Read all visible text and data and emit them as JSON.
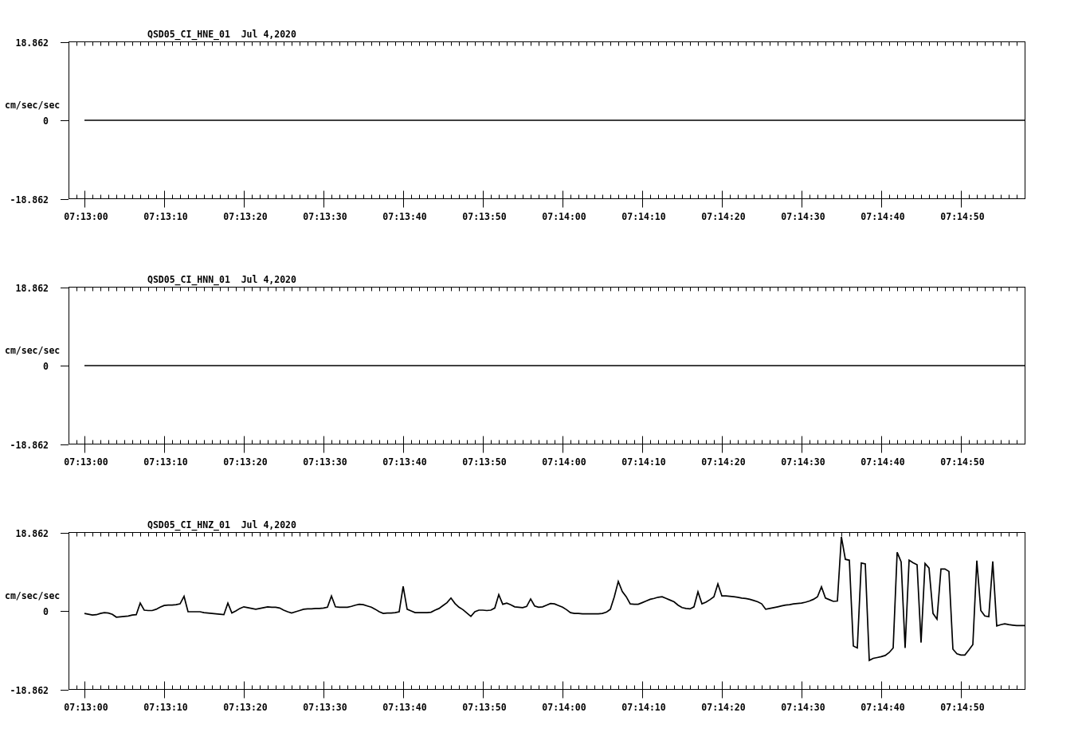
{
  "panels": [
    {
      "chart_data": {
        "type": "line",
        "title": "QSD05_CI_HNE_01  Jul 4,2020",
        "ylabel": "cm/sec/sec",
        "ylim": [
          -18.862,
          18.862
        ],
        "yticks": [
          {
            "value": 18.862,
            "label": "18.862"
          },
          {
            "value": 0,
            "label": "0"
          },
          {
            "value": -18.862,
            "label": "-18.862"
          }
        ],
        "categories": [
          null,
          "07:13:00",
          null,
          null,
          null,
          null,
          "07:13:10",
          null,
          null,
          null,
          null,
          "07:13:20",
          null,
          null,
          null,
          null,
          "07:13:30",
          null,
          null,
          null,
          null,
          "07:13:40",
          null,
          null,
          null,
          null,
          "07:13:50",
          null,
          null,
          null,
          null,
          "07:14:00",
          null,
          null,
          null,
          null,
          "07:14:10",
          null,
          null,
          null,
          null,
          "07:14:20",
          null,
          null,
          null,
          null,
          "07:14:30",
          null,
          null,
          null,
          null,
          "07:14:40",
          null,
          null,
          null,
          null,
          "07:14:50",
          null,
          null,
          null,
          null
        ],
        "values": [
          null,
          0,
          0,
          0,
          0,
          0,
          0,
          0,
          0,
          0,
          0,
          0,
          0,
          0,
          0,
          0,
          0,
          0,
          0,
          0,
          0,
          0,
          0,
          0,
          0,
          0,
          0,
          0,
          0,
          0,
          0,
          0,
          0,
          0,
          0,
          0,
          0,
          0,
          0,
          0,
          0,
          0,
          0,
          0,
          0,
          0,
          0,
          0,
          0,
          0,
          0,
          0,
          0,
          0,
          0,
          0,
          0,
          0,
          0,
          0,
          0
        ]
      }
    },
    {
      "chart_data": {
        "type": "line",
        "title": "QSD05_CI_HNN_01  Jul 4,2020",
        "ylabel": "cm/sec/sec",
        "ylim": [
          -18.862,
          18.862
        ],
        "yticks": [
          {
            "value": 18.862,
            "label": "18.862"
          },
          {
            "value": 0,
            "label": "0"
          },
          {
            "value": -18.862,
            "label": "-18.862"
          }
        ],
        "categories": [
          null,
          "07:13:00",
          null,
          null,
          null,
          null,
          "07:13:10",
          null,
          null,
          null,
          null,
          "07:13:20",
          null,
          null,
          null,
          null,
          "07:13:30",
          null,
          null,
          null,
          null,
          "07:13:40",
          null,
          null,
          null,
          null,
          "07:13:50",
          null,
          null,
          null,
          null,
          "07:14:00",
          null,
          null,
          null,
          null,
          "07:14:10",
          null,
          null,
          null,
          null,
          "07:14:20",
          null,
          null,
          null,
          null,
          "07:14:30",
          null,
          null,
          null,
          null,
          "07:14:40",
          null,
          null,
          null,
          null,
          "07:14:50",
          null,
          null,
          null,
          null
        ],
        "values": [
          null,
          0,
          0,
          0,
          0,
          0,
          0,
          0,
          0,
          0,
          0,
          0,
          0,
          0,
          0,
          0,
          0,
          0,
          0,
          0,
          0,
          0,
          0,
          0,
          0,
          0,
          0,
          0,
          0,
          0,
          0,
          0,
          0,
          0,
          0,
          0,
          0,
          0,
          0,
          0,
          0,
          0,
          0,
          0,
          0,
          0,
          0,
          0,
          0,
          0,
          0,
          0,
          0,
          0,
          0,
          0,
          0,
          0,
          0,
          0,
          0
        ]
      }
    },
    {
      "chart_data": {
        "type": "line",
        "title": "QSD05_CI_HNZ_01  Jul 4,2020",
        "ylabel": "cm/sec/sec",
        "ylim": [
          -18.862,
          18.862
        ],
        "yticks": [
          {
            "value": 18.862,
            "label": "18.862"
          },
          {
            "value": 0,
            "label": "0"
          },
          {
            "value": -18.862,
            "label": "-18.862"
          }
        ],
        "categories": [
          null,
          null,
          null,
          null,
          "07:13:00",
          null,
          null,
          null,
          null,
          null,
          null,
          null,
          null,
          null,
          null,
          null,
          null,
          null,
          null,
          null,
          null,
          null,
          null,
          null,
          "07:13:10",
          null,
          null,
          null,
          null,
          null,
          null,
          null,
          null,
          null,
          null,
          null,
          null,
          null,
          null,
          null,
          null,
          null,
          null,
          null,
          "07:13:20",
          null,
          null,
          null,
          null,
          null,
          null,
          null,
          null,
          null,
          null,
          null,
          null,
          null,
          null,
          null,
          null,
          null,
          null,
          null,
          "07:13:30",
          null,
          null,
          null,
          null,
          null,
          null,
          null,
          null,
          null,
          null,
          null,
          null,
          null,
          null,
          null,
          null,
          null,
          null,
          null,
          "07:13:40",
          null,
          null,
          null,
          null,
          null,
          null,
          null,
          null,
          null,
          null,
          null,
          null,
          null,
          null,
          null,
          null,
          null,
          null,
          null,
          "07:13:50",
          null,
          null,
          null,
          null,
          null,
          null,
          null,
          null,
          null,
          null,
          null,
          null,
          null,
          null,
          null,
          null,
          null,
          null,
          null,
          "07:14:00",
          null,
          null,
          null,
          null,
          null,
          null,
          null,
          null,
          null,
          null,
          null,
          null,
          null,
          null,
          null,
          null,
          null,
          null,
          null,
          "07:14:10",
          null,
          null,
          null,
          null,
          null,
          null,
          null,
          null,
          null,
          null,
          null,
          null,
          null,
          null,
          null,
          null,
          null,
          null,
          null,
          "07:14:20",
          null,
          null,
          null,
          null,
          null,
          null,
          null,
          null,
          null,
          null,
          null,
          null,
          null,
          null,
          null,
          null,
          null,
          null,
          null,
          "07:14:30",
          null,
          null,
          null,
          null,
          null,
          null,
          null,
          null,
          null,
          null,
          null,
          null,
          null,
          null,
          null,
          null,
          null,
          null,
          null,
          "07:14:40",
          null,
          null,
          null,
          null,
          null,
          null,
          null,
          null,
          null,
          null,
          null,
          null,
          null,
          null,
          null,
          null,
          null,
          null,
          null,
          "07:14:50",
          null,
          null,
          null,
          null,
          null,
          null,
          null,
          null,
          null,
          null,
          null,
          null,
          null,
          null,
          null,
          null
        ],
        "values": [
          null,
          null,
          null,
          null,
          -0.6,
          -0.8,
          -1.0,
          -0.9,
          -0.6,
          -0.4,
          -0.5,
          -0.8,
          -1.5,
          -1.4,
          -1.3,
          -1.2,
          -1.0,
          -0.9,
          1.9,
          0.2,
          0.1,
          0.1,
          0.4,
          0.9,
          1.3,
          1.4,
          1.4,
          1.5,
          1.7,
          3.5,
          -0.2,
          -0.2,
          -0.2,
          -0.2,
          -0.4,
          -0.5,
          -0.6,
          -0.7,
          -0.8,
          -0.9,
          1.9,
          -0.5,
          0.0,
          0.6,
          1.0,
          0.8,
          0.6,
          0.4,
          0.6,
          0.8,
          1.0,
          0.9,
          0.9,
          0.7,
          0.2,
          -0.2,
          -0.5,
          -0.2,
          0.1,
          0.4,
          0.5,
          0.5,
          0.6,
          0.6,
          0.7,
          0.9,
          3.6,
          1.0,
          0.9,
          0.9,
          0.9,
          1.1,
          1.4,
          1.6,
          1.5,
          1.2,
          0.9,
          0.4,
          -0.2,
          -0.6,
          -0.5,
          -0.5,
          -0.4,
          -0.2,
          5.9,
          0.4,
          0.0,
          -0.4,
          -0.4,
          -0.4,
          -0.4,
          -0.3,
          0.2,
          0.6,
          1.3,
          2.0,
          3.1,
          1.8,
          0.9,
          0.3,
          -0.5,
          -1.3,
          -0.2,
          0.2,
          0.2,
          0.1,
          0.2,
          0.7,
          3.9,
          1.6,
          1.9,
          1.5,
          1.0,
          0.9,
          0.8,
          1.1,
          2.9,
          1.2,
          0.9,
          1.0,
          1.4,
          1.8,
          1.7,
          1.3,
          0.9,
          0.3,
          -0.4,
          -0.6,
          -0.6,
          -0.7,
          -0.7,
          -0.7,
          -0.7,
          -0.7,
          -0.6,
          -0.3,
          0.4,
          3.4,
          7.1,
          4.7,
          3.4,
          1.7,
          1.6,
          1.6,
          2.0,
          2.4,
          2.8,
          3.0,
          3.3,
          3.4,
          3.0,
          2.6,
          2.2,
          1.4,
          0.8,
          0.6,
          0.5,
          1.0,
          4.6,
          1.7,
          2.1,
          2.7,
          3.4,
          6.5,
          3.6,
          3.6,
          3.5,
          3.4,
          3.3,
          3.1,
          3.0,
          2.8,
          2.5,
          2.2,
          1.7,
          0.4,
          0.6,
          0.8,
          1.0,
          1.2,
          1.4,
          1.5,
          1.7,
          1.8,
          1.9,
          2.1,
          2.4,
          2.8,
          3.4,
          5.8,
          3.1,
          2.7,
          2.3,
          2.4,
          17.8,
          12.4,
          12.2,
          -8.4,
          -8.9,
          11.5,
          11.3,
          -11.9,
          -11.4,
          -11.2,
          -11.0,
          -10.7,
          -10.0,
          -8.9,
          14.1,
          11.8,
          -8.9,
          12.2,
          11.6,
          11.1,
          -7.6,
          11.4,
          10.3,
          -0.6,
          -2.0,
          10.1,
          10.1,
          9.5,
          -9.2,
          -10.3,
          -10.6,
          -10.6,
          -9.4,
          -8.1,
          12.1,
          0.1,
          -1.2,
          -1.4,
          11.9,
          -3.6,
          -3.3,
          -3.1,
          -3.3,
          -3.4,
          -3.5,
          -3.5,
          -3.5
        ]
      }
    }
  ]
}
